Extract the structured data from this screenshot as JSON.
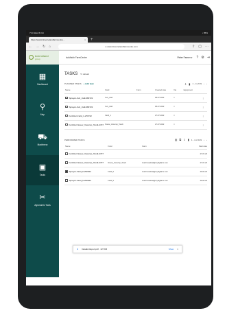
{
  "status": {
    "left": "7:41  Wed 6 Oct",
    "right": "• 85%"
  },
  "browser": {
    "tab_title": "https://www2.kvernelandfarmcentre...",
    "url": "● www2.kvernelandfarmcentre.com"
  },
  "header": {
    "logo_text": "kverneland",
    "logo_sub": "group",
    "app_title": "IsoMatch FarmCentre",
    "user_name": "Pieter Farmer"
  },
  "sidebar": {
    "items": [
      {
        "label": "Dashboard",
        "icon": "dashboard-icon"
      },
      {
        "label": "Map",
        "icon": "map-pin-icon"
      },
      {
        "label": "Machinery",
        "icon": "tractor-icon"
      },
      {
        "label": "Tasks",
        "icon": "calendar-icon"
      },
      {
        "label": "Agronomic Tools",
        "icon": "tools-icon"
      }
    ]
  },
  "main": {
    "title": "TASKS",
    "refresh_label": "refresh",
    "planned": {
      "heading": "PLANNED TASKS",
      "add_label": "+ Add task",
      "pagination": "1 - 4 of 99",
      "columns": [
        "Name",
        "Field",
        "Farm",
        "Created date",
        "Via",
        "Equipment"
      ],
      "rows": [
        {
          "name": "Sprayer-Kvû_triall-080722",
          "field": "Kvû_triall",
          "farm": "",
          "date": "08-07-2022",
          "via": "□"
        },
        {
          "name": "Sprayer-Kvû_triall-080722",
          "field": "Kvû_triall",
          "farm": "",
          "date": "08-07-2022",
          "via": "□"
        },
        {
          "name": "Fertilizer-Field_1-270722",
          "field": "Field_1",
          "farm": "",
          "date": "27-07-2022",
          "via": "□"
        },
        {
          "name": "Fertilizer-Nieuw_Vewvrsp_Tandt-2707",
          "field": "Nieuw_Vewvrsp_Tandt",
          "farm": "",
          "date": "27-07-2022",
          "via": "□"
        }
      ]
    },
    "performed": {
      "heading": "PERFORMED TASKS",
      "pagination": "1 - 4 of 139",
      "columns": [
        "Name",
        "Field",
        "Farm",
        "Start date"
      ],
      "rows": [
        {
          "name": "Fertilizer-Nieuw_Vewvrsp_Tandt-2707",
          "field": "",
          "farm": "",
          "date": "27-07-20",
          "checked": false
        },
        {
          "name": "Fertilizer-Nieuw_Vewvrsp_Tandt-2707",
          "field": "Nieuw_Vewvrsp_Tandt",
          "farm": "kva0 kvaeland@mydigifarm.com",
          "date": "27-07-20",
          "checked": false
        },
        {
          "name": "Sprayer-Field_5-290622",
          "field": "Field_5",
          "farm": "kva0 kvaeland@mydigifarm.com",
          "date": "29-06-20",
          "checked": true
        },
        {
          "name": "Sprayer-Field_5-290622",
          "field": "Field_5",
          "farm": "kva0 kvaeland@mydigifarm.com",
          "date": "29-06-20",
          "checked": false
        }
      ]
    }
  },
  "download": {
    "filename": "Details Report.pdf · 137 KB",
    "show_label": "Show",
    "close_label": "×"
  }
}
